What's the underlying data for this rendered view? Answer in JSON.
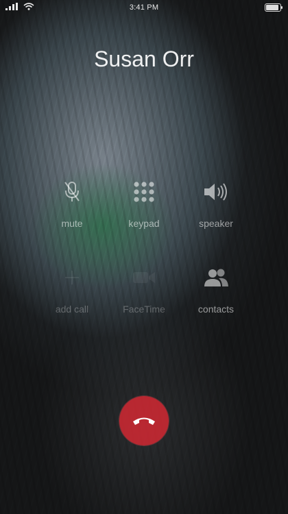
{
  "status_bar": {
    "time": "3:41 PM",
    "signal_icon": "signal-bars-icon",
    "wifi_icon": "wifi-icon",
    "battery_icon": "battery-icon",
    "battery_level": 1.0
  },
  "caller": {
    "name": "Susan Orr"
  },
  "controls": {
    "mute": {
      "label": "mute",
      "icon": "mute-microphone-icon"
    },
    "keypad": {
      "label": "keypad",
      "icon": "keypad-icon"
    },
    "speaker": {
      "label": "speaker",
      "icon": "speaker-icon"
    },
    "add_call": {
      "label": "add call",
      "icon": "add-icon"
    },
    "facetime": {
      "label": "FaceTime",
      "icon": "facetime-icon"
    },
    "contacts": {
      "label": "contacts",
      "icon": "contacts-icon"
    }
  },
  "end_call": {
    "icon": "end-call-icon",
    "color": "#d2282f"
  }
}
